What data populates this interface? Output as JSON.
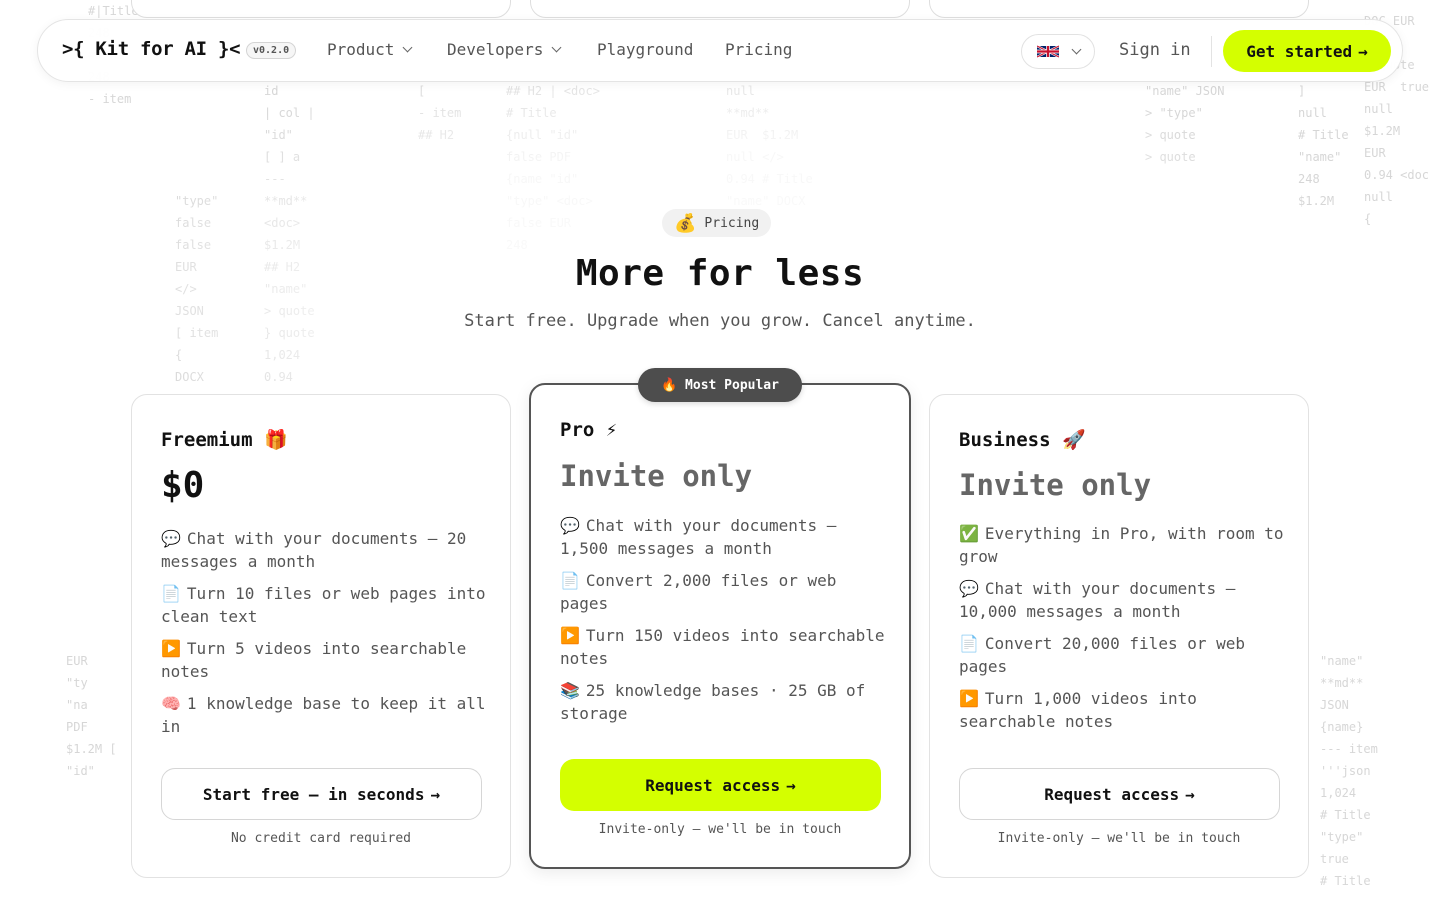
{
  "nav": {
    "logo": ">{ Kit for AI }<",
    "version": "v0.2.0",
    "links": [
      {
        "label": "Product"
      },
      {
        "label": "Developers"
      },
      {
        "label": "Playground"
      },
      {
        "label": "Pricing"
      }
    ],
    "language_flag": "🇬🇧",
    "sign_in": "Sign in",
    "cta": "Get started"
  },
  "hero": {
    "badge_emoji": "💰",
    "badge_label": "Pricing",
    "title": "More for less",
    "subtitle": "Start free. Upgrade when you grow. Cancel anytime."
  },
  "plans": [
    {
      "name": "Freemium 🎁",
      "price": "$0",
      "features": [
        {
          "emoji": "💬",
          "text": "Chat with your documents — 20 messages a month"
        },
        {
          "emoji": "📄",
          "text": "Turn 10 files or web pages into clean text"
        },
        {
          "emoji": "▶️",
          "text": "Turn 5 videos into searchable notes"
        },
        {
          "emoji": "🧠",
          "text": "1 knowledge base to keep it all in"
        }
      ],
      "button": "Start free — in seconds",
      "note": "No credit card required"
    },
    {
      "name": "Pro ⚡",
      "price": "Invite only",
      "badge": "🔥 Most Popular",
      "features": [
        {
          "emoji": "💬",
          "text": "Chat with your documents — 1,500 messages a month"
        },
        {
          "emoji": "📄",
          "text": "Convert 2,000 files or web pages"
        },
        {
          "emoji": "▶️",
          "text": "Turn 150 videos into searchable notes"
        },
        {
          "emoji": "📚",
          "text": "25 knowledge bases · 25 GB of storage"
        }
      ],
      "button": "Request access",
      "note": "Invite-only — we'll be in touch"
    },
    {
      "name": "Business 🚀",
      "price": "Invite only",
      "features": [
        {
          "emoji": "✅",
          "text": "Everything in Pro, with room to grow"
        },
        {
          "emoji": "💬",
          "text": "Chat with your documents — 10,000 messages a month"
        },
        {
          "emoji": "📄",
          "text": "Convert 20,000 files or web pages"
        },
        {
          "emoji": "▶️",
          "text": "Turn 1,000 videos into searchable notes"
        }
      ],
      "button": "Request access",
      "note": "Invite-only — we'll be in touch"
    }
  ],
  "colors": {
    "accent": "#d4ff00",
    "badge_dark": "#4d4d4d"
  }
}
